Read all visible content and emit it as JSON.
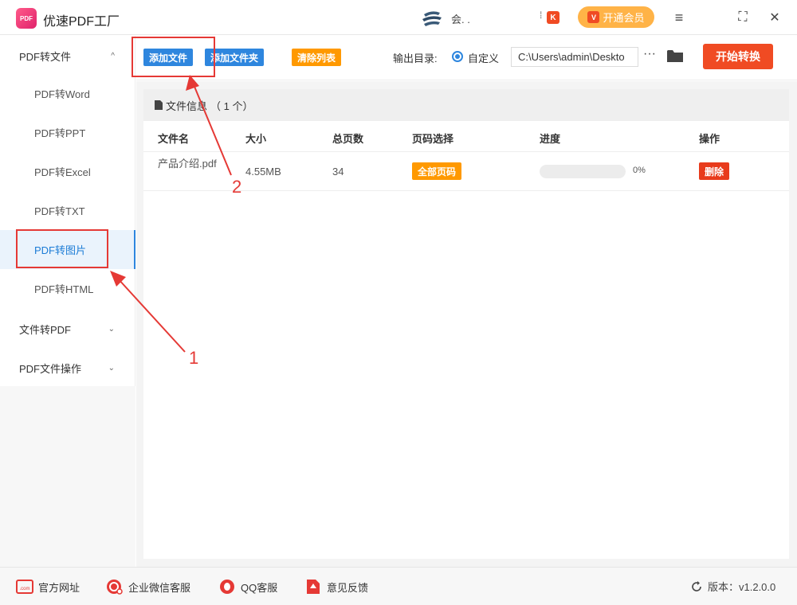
{
  "app": {
    "title": "优速PDF工厂",
    "logo_text": "PDF",
    "user_name": "会. .",
    "vip_label": "开通会员",
    "vip_icon_text": "V",
    "bell_glyph": "⁞",
    "k_icon_text": "K"
  },
  "window_icons": {
    "menu": "≡",
    "maximize": "⛶",
    "close": "✕"
  },
  "sidebar": {
    "group1": {
      "label": "PDF转文件",
      "chevron": "^"
    },
    "items": [
      {
        "label": "PDF转Word"
      },
      {
        "label": "PDF转PPT"
      },
      {
        "label": "PDF转Excel"
      },
      {
        "label": "PDF转TXT"
      },
      {
        "label": "PDF转图片"
      },
      {
        "label": "PDF转HTML"
      }
    ],
    "group2": {
      "label": "文件转PDF",
      "chevron": "⌄"
    },
    "group3": {
      "label": "PDF文件操作",
      "chevron": "⌄"
    }
  },
  "toolbar": {
    "add_file": "添加文件",
    "add_folder": "添加文件夹",
    "clear_list": "清除列表",
    "output_label": "输出目录:",
    "custom_label": "自定义",
    "path_value": "C:\\Users\\admin\\Deskto",
    "more": "···",
    "start": "开始转换"
  },
  "panel": {
    "title": "文件信息",
    "count": "（ 1 个）"
  },
  "table": {
    "headers": [
      "文件名",
      "大小",
      "总页数",
      "页码选择",
      "进度",
      "操作"
    ],
    "rows": [
      {
        "name": "产品介绍.pdf",
        "size": "4.55MB",
        "pages": "34",
        "page_select": "全部页码",
        "progress": "0%",
        "action": "删除"
      }
    ]
  },
  "footer": {
    "website": "官方网址",
    "website_icon_text": ".com",
    "wechat": "企业微信客服",
    "qq": "QQ客服",
    "feedback": "意见反馈",
    "version": "版本：v1.2.0.0"
  },
  "annotations": {
    "one": "1",
    "two": "2"
  },
  "colors": {
    "primary_blue": "#2e86de",
    "orange": "#ff9900",
    "red": "#f04b23",
    "annotation_red": "#e53935"
  }
}
